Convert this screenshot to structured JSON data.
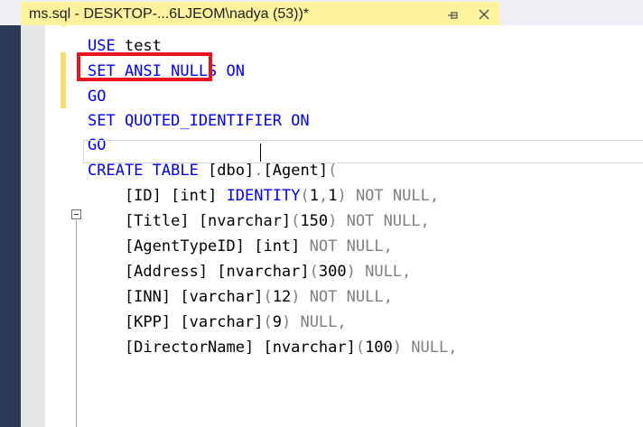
{
  "tab": {
    "title": "ms.sql - DESKTOP-...6LJEOM\\nadya (53))*"
  },
  "code_lines": [
    [
      {
        "t": "USE",
        "c": "kw"
      },
      {
        "t": " test",
        "c": "tx"
      }
    ],
    [
      {
        "t": "SET ANSI_NULLS ON",
        "c": "kw"
      }
    ],
    [
      {
        "t": "GO",
        "c": "kw"
      }
    ],
    [
      {
        "t": "SET QUOTED_IDENTIFIER ON",
        "c": "kw"
      }
    ],
    [
      {
        "t": "GO",
        "c": "kw"
      }
    ],
    [
      {
        "t": "CREATE TABLE",
        "c": "kw"
      },
      {
        "t": " [dbo]",
        "c": "tx"
      },
      {
        "t": ".",
        "c": "gr"
      },
      {
        "t": "[Agent]",
        "c": "tx"
      },
      {
        "t": "(",
        "c": "gr"
      }
    ],
    [
      {
        "t": "    [ID] ",
        "c": "tx"
      },
      {
        "t": "[int]",
        "c": "tx"
      },
      {
        "t": " ",
        "c": "tx"
      },
      {
        "t": "IDENTITY",
        "c": "kw"
      },
      {
        "t": "(",
        "c": "gr"
      },
      {
        "t": "1",
        "c": "tx"
      },
      {
        "t": ",",
        "c": "gr"
      },
      {
        "t": "1",
        "c": "tx"
      },
      {
        "t": ")",
        "c": "gr"
      },
      {
        "t": " NOT NULL,",
        "c": "gr"
      }
    ],
    [
      {
        "t": "    [Title] [nvarchar]",
        "c": "tx"
      },
      {
        "t": "(",
        "c": "gr"
      },
      {
        "t": "150",
        "c": "tx"
      },
      {
        "t": ")",
        "c": "gr"
      },
      {
        "t": " NOT NULL,",
        "c": "gr"
      }
    ],
    [
      {
        "t": "    [AgentTypeID] [int]",
        "c": "tx"
      },
      {
        "t": " NOT NULL,",
        "c": "gr"
      }
    ],
    [
      {
        "t": "    [Address] [nvarchar]",
        "c": "tx"
      },
      {
        "t": "(",
        "c": "gr"
      },
      {
        "t": "300",
        "c": "tx"
      },
      {
        "t": ")",
        "c": "gr"
      },
      {
        "t": " NULL,",
        "c": "gr"
      }
    ],
    [
      {
        "t": "    [INN] [varchar]",
        "c": "tx"
      },
      {
        "t": "(",
        "c": "gr"
      },
      {
        "t": "12",
        "c": "tx"
      },
      {
        "t": ")",
        "c": "gr"
      },
      {
        "t": " NOT NULL,",
        "c": "gr"
      }
    ],
    [
      {
        "t": "    [KPP] [varchar]",
        "c": "tx"
      },
      {
        "t": "(",
        "c": "gr"
      },
      {
        "t": "9",
        "c": "tx"
      },
      {
        "t": ")",
        "c": "gr"
      },
      {
        "t": " NULL,",
        "c": "gr"
      }
    ],
    [
      {
        "t": "    [DirectorName] [nvarchar]",
        "c": "tx"
      },
      {
        "t": "(",
        "c": "gr"
      },
      {
        "t": "100",
        "c": "tx"
      },
      {
        "t": ")",
        "c": "gr"
      },
      {
        "t": " NULL,",
        "c": "gr"
      }
    ]
  ],
  "colors": {
    "keyword": "#0000ff",
    "function": "#ff00ff",
    "gray": "#808080",
    "tab_active": "#fff29d",
    "highlight_box": "#e8141d",
    "change_bar": "#f3dd6b"
  },
  "icons": {
    "pin": "pin-icon",
    "close": "close-icon",
    "collapse": "collapse-icon"
  }
}
